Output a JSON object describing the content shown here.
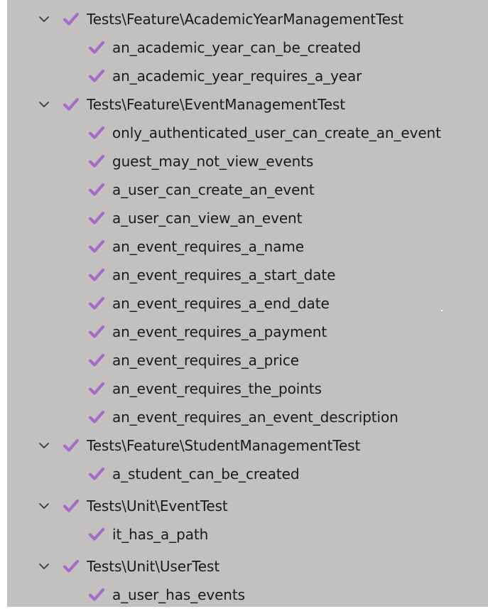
{
  "colors": {
    "panel_background": "#c3c1bf",
    "check_color": "#a66bc6",
    "chevron_color": "#3a3a3a",
    "text_color": "#1a1a1a"
  },
  "icons": {
    "expand": "chevron-down-icon",
    "passed": "checkmark-icon"
  },
  "suites": [
    {
      "name": "Tests\\Feature\\AcademicYearManagementTest",
      "status": "passed",
      "expanded": true,
      "tests": [
        {
          "name": "an_academic_year_can_be_created",
          "status": "passed"
        },
        {
          "name": "an_academic_year_requires_a_year",
          "status": "passed"
        }
      ]
    },
    {
      "name": "Tests\\Feature\\EventManagementTest",
      "status": "passed",
      "expanded": true,
      "tests": [
        {
          "name": "only_authenticated_user_can_create_an_event",
          "status": "passed"
        },
        {
          "name": "guest_may_not_view_events",
          "status": "passed"
        },
        {
          "name": "a_user_can_create_an_event",
          "status": "passed"
        },
        {
          "name": "a_user_can_view_an_event",
          "status": "passed"
        },
        {
          "name": "an_event_requires_a_name",
          "status": "passed"
        },
        {
          "name": "an_event_requires_a_start_date",
          "status": "passed"
        },
        {
          "name": "an_event_requires_a_end_date",
          "status": "passed"
        },
        {
          "name": "an_event_requires_a_payment",
          "status": "passed"
        },
        {
          "name": "an_event_requires_a_price",
          "status": "passed"
        },
        {
          "name": "an_event_requires_the_points",
          "status": "passed"
        },
        {
          "name": "an_event_requires_an_event_description",
          "status": "passed"
        }
      ]
    },
    {
      "name": "Tests\\Feature\\StudentManagementTest",
      "status": "passed",
      "expanded": true,
      "tests": [
        {
          "name": "a_student_can_be_created",
          "status": "passed"
        }
      ]
    },
    {
      "name": "Tests\\Unit\\EventTest",
      "status": "passed",
      "expanded": true,
      "tests": [
        {
          "name": "it_has_a_path",
          "status": "passed"
        }
      ]
    },
    {
      "name": "Tests\\Unit\\UserTest",
      "status": "passed",
      "expanded": true,
      "tests": [
        {
          "name": "a_user_has_events",
          "status": "passed"
        }
      ]
    }
  ]
}
